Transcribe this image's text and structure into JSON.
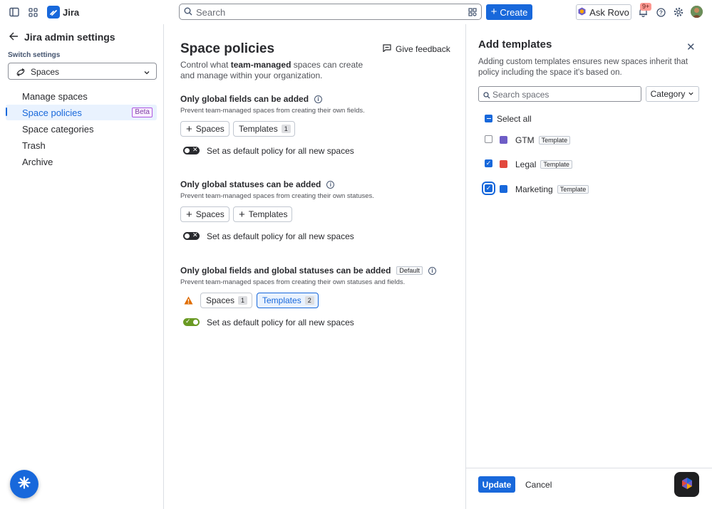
{
  "topbar": {
    "app_name": "Jira",
    "search_placeholder": "Search",
    "create_label": "Create",
    "ask_rovo_label": "Ask Rovo",
    "notifications_badge": "9+"
  },
  "sidebar": {
    "title": "Jira admin settings",
    "switch_label": "Switch settings",
    "switch_value": "Spaces",
    "items": [
      {
        "label": "Manage spaces"
      },
      {
        "label": "Space policies",
        "badge": "Beta",
        "active": true
      },
      {
        "label": "Space categories"
      },
      {
        "label": "Trash"
      },
      {
        "label": "Archive"
      }
    ]
  },
  "main": {
    "title": "Space policies",
    "feedback_label": "Give feedback",
    "desc_pre": "Control what ",
    "desc_bold": "team-managed",
    "desc_post": " spaces can create and manage within your organization.",
    "sections": [
      {
        "title": "Only global fields can be added",
        "desc": "Prevent team-managed spaces from creating their own fields.",
        "spaces_label": "Spaces",
        "templates_label": "Templates",
        "templates_count": "1",
        "toggle_label": "Set as default policy for all new spaces",
        "toggle_on": false
      },
      {
        "title": "Only global statuses can be added",
        "desc": "Prevent team-managed spaces from creating their own statuses.",
        "spaces_label": "Spaces",
        "templates_label": "Templates",
        "toggle_label": "Set as default policy for all new spaces",
        "toggle_on": false
      },
      {
        "title": "Only global fields and global statuses can be added",
        "default_badge": "Default",
        "desc": "Prevent team-managed spaces from creating their own statuses and fields.",
        "spaces_label": "Spaces",
        "spaces_count": "1",
        "templates_label": "Templates",
        "templates_count": "2",
        "toggle_label": "Set as default policy for all new spaces",
        "toggle_on": true
      }
    ]
  },
  "panel": {
    "title": "Add templates",
    "desc": "Adding custom templates ensures new spaces inherit that policy including the space it's based on.",
    "search_placeholder": "Search spaces",
    "category_label": "Category",
    "select_all_label": "Select all",
    "items": [
      {
        "name": "GTM",
        "badge": "Template",
        "checked": false,
        "color": "#6e5dc6"
      },
      {
        "name": "Legal",
        "badge": "Template",
        "checked": true,
        "color": "#e2483d"
      },
      {
        "name": "Marketing",
        "badge": "Template",
        "checked": true,
        "color": "#1868db"
      }
    ],
    "update_label": "Update",
    "cancel_label": "Cancel"
  },
  "colors": {
    "accent": "#1868db",
    "toggle_on": "#6a9a23",
    "warning": "#e06c00"
  }
}
